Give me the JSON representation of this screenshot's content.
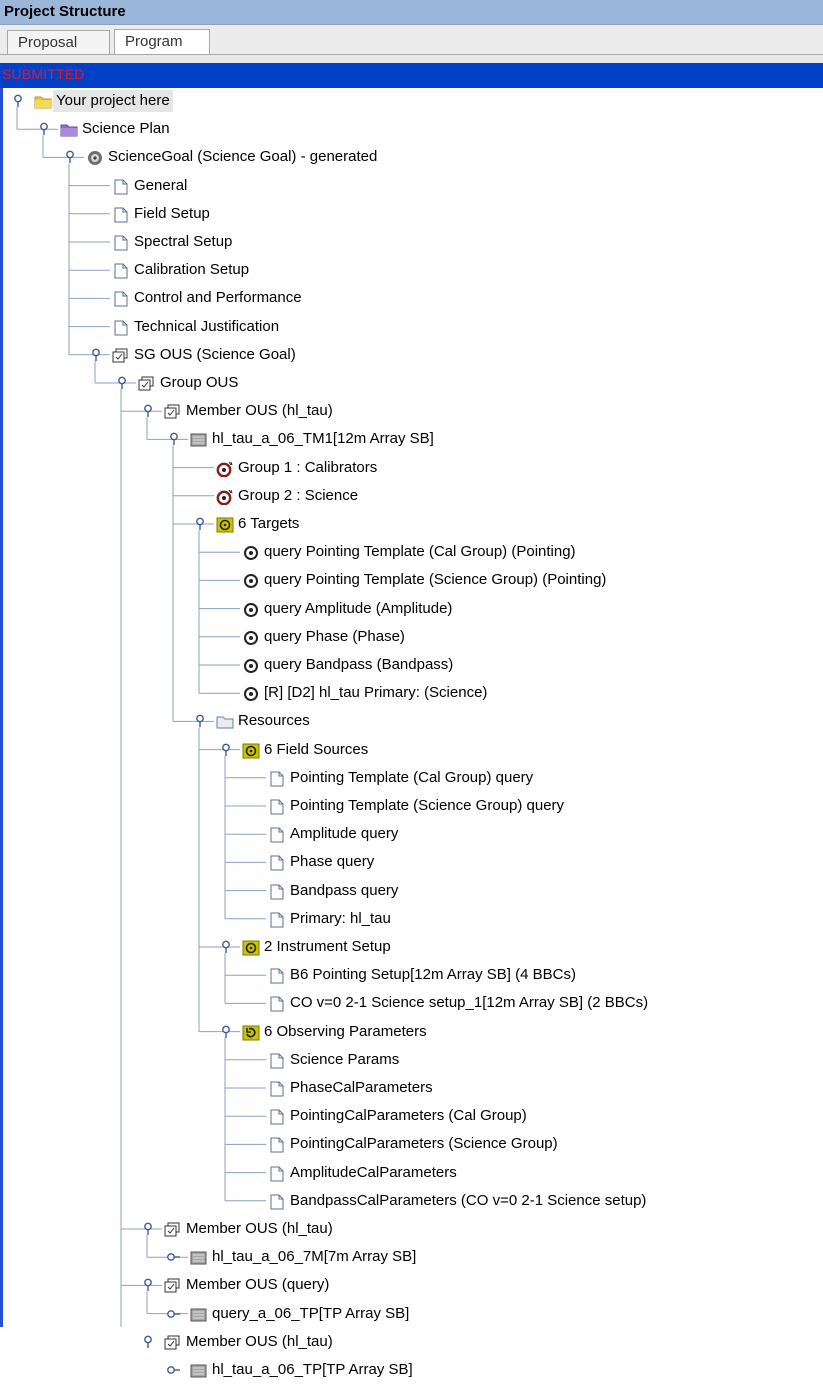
{
  "window": {
    "title": "Project Structure"
  },
  "tabs": [
    {
      "label": "Proposal",
      "active": false
    },
    {
      "label": "Program",
      "active": true
    }
  ],
  "status": {
    "text": "SUBMITTED",
    "color": "#e0182a",
    "background": "#0041c8"
  },
  "tree": {
    "nodes": [
      {
        "label": "Your project here",
        "icon": "folder-yellow-icon",
        "expanded": true,
        "selected": true
      },
      {
        "label": "Science Plan",
        "icon": "folder-purple-icon",
        "expanded": true
      },
      {
        "label": "ScienceGoal (Science Goal) - generated",
        "icon": "science-goal-icon",
        "expanded": true
      },
      {
        "label": "General",
        "icon": "document-icon"
      },
      {
        "label": "Field Setup",
        "icon": "document-icon"
      },
      {
        "label": "Spectral Setup",
        "icon": "document-icon"
      },
      {
        "label": "Calibration Setup",
        "icon": "document-icon"
      },
      {
        "label": "Control and Performance",
        "icon": "document-icon"
      },
      {
        "label": "Technical Justification",
        "icon": "document-icon"
      },
      {
        "label": "SG OUS (Science Goal)",
        "icon": "ous-icon",
        "expanded": true
      },
      {
        "label": "Group OUS",
        "icon": "ous-icon",
        "expanded": true
      },
      {
        "label": "Member OUS (hl_tau)",
        "icon": "ous-icon",
        "expanded": true
      },
      {
        "label": "hl_tau_a_06_TM1[12m Array SB]",
        "icon": "scheduling-block-icon",
        "expanded": true
      },
      {
        "label": "Group 1 : Calibrators",
        "icon": "group-target-icon"
      },
      {
        "label": "Group 2 : Science",
        "icon": "group-target-icon"
      },
      {
        "label": "6 Targets",
        "icon": "target-folder-icon",
        "expanded": true
      },
      {
        "label": "query Pointing Template (Cal Group) (Pointing)",
        "icon": "target-icon"
      },
      {
        "label": "query Pointing Template (Science Group) (Pointing)",
        "icon": "target-icon"
      },
      {
        "label": "query Amplitude (Amplitude)",
        "icon": "target-icon"
      },
      {
        "label": "query Phase (Phase)",
        "icon": "target-icon"
      },
      {
        "label": "query Bandpass (Bandpass)",
        "icon": "target-icon"
      },
      {
        "label": "[R] [D2] hl_tau Primary: (Science)",
        "icon": "target-icon"
      },
      {
        "label": "Resources",
        "icon": "folder-icon",
        "expanded": true
      },
      {
        "label": "6 Field Sources",
        "icon": "target-folder-icon",
        "expanded": true
      },
      {
        "label": "Pointing Template (Cal Group) query",
        "icon": "document-icon"
      },
      {
        "label": "Pointing Template (Science Group) query",
        "icon": "document-icon"
      },
      {
        "label": "Amplitude query",
        "icon": "document-icon"
      },
      {
        "label": "Phase query",
        "icon": "document-icon"
      },
      {
        "label": "Bandpass query",
        "icon": "document-icon"
      },
      {
        "label": "Primary: hl_tau",
        "icon": "document-icon"
      },
      {
        "label": "2 Instrument Setup",
        "icon": "target-folder-icon",
        "expanded": true
      },
      {
        "label": "B6 Pointing Setup[12m Array SB] (4 BBCs)",
        "icon": "document-icon"
      },
      {
        "label": "CO v=0 2-1 Science setup_1[12m Array SB] (2 BBCs)",
        "icon": "document-icon"
      },
      {
        "label": "6 Observing Parameters",
        "icon": "observing-parameters-icon",
        "expanded": true
      },
      {
        "label": "Science Params",
        "icon": "document-icon"
      },
      {
        "label": "PhaseCalParameters",
        "icon": "document-icon"
      },
      {
        "label": "PointingCalParameters (Cal Group)",
        "icon": "document-icon"
      },
      {
        "label": "PointingCalParameters (Science Group)",
        "icon": "document-icon"
      },
      {
        "label": "AmplitudeCalParameters",
        "icon": "document-icon"
      },
      {
        "label": "BandpassCalParameters (CO v=0 2-1 Science setup)",
        "icon": "document-icon"
      },
      {
        "label": "Member OUS (hl_tau)",
        "icon": "ous-icon",
        "expanded": true
      },
      {
        "label": "hl_tau_a_06_7M[7m Array SB]",
        "icon": "scheduling-block-icon",
        "expanded": false
      },
      {
        "label": "Member OUS (query)",
        "icon": "ous-icon",
        "expanded": true
      },
      {
        "label": "query_a_06_TP[TP Array SB]",
        "icon": "scheduling-block-icon",
        "expanded": false
      },
      {
        "label": "Member OUS (hl_tau)",
        "icon": "ous-icon",
        "expanded": true
      },
      {
        "label": "hl_tau_a_06_TP[TP Array SB]",
        "icon": "scheduling-block-icon",
        "expanded": false
      }
    ]
  }
}
